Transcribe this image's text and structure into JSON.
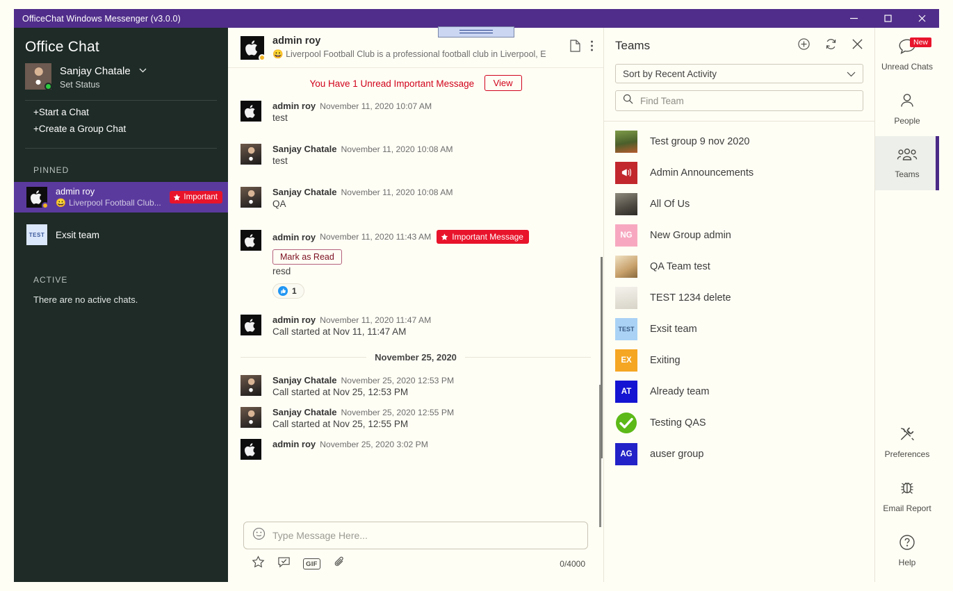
{
  "window": {
    "title": "OfficeChat Windows Messenger (v3.0.0)",
    "minimize": "–",
    "maximize": "□",
    "close": "✕",
    "titlebar_color": "#502D8A"
  },
  "sidebar": {
    "brand": "Office Chat",
    "user": {
      "name": "Sanjay Chatale",
      "status": "Set Status",
      "presence_color": "#2ECC40"
    },
    "actions": [
      {
        "label": "+Start a Chat"
      },
      {
        "label": "+Create a Group Chat"
      }
    ],
    "pinned_header": "PINNED",
    "pinned": [
      {
        "name": "admin roy",
        "preview": "Liverpool Football Club...",
        "emoji": "😀",
        "badge": "Important",
        "badge_color": "#E8142B",
        "selected": true,
        "avatar_type": "apple",
        "presence_color": "#F0B323"
      },
      {
        "name": "Exsit team",
        "preview": "",
        "badge": "",
        "selected": false,
        "avatar_type": "test",
        "avatar_text": "TEST"
      }
    ],
    "active_header": "ACTIVE",
    "active_empty": "There are no active chats."
  },
  "chat": {
    "header": {
      "name": "admin roy",
      "emoji": "😀",
      "status_text": "Liverpool Football Club is a professional football club in Liverpool, E",
      "presence_color": "#F0B323"
    },
    "unread_banner": {
      "text": "You Have 1 Unread Important Message",
      "button": "View",
      "color": "#D0021B"
    },
    "messages": [
      {
        "author": "admin roy",
        "time": "November 11, 2020 10:07 AM",
        "text": "test",
        "avatar": "apple"
      },
      {
        "author": "Sanjay Chatale",
        "time": "November 11, 2020 10:08 AM",
        "text": "test",
        "avatar": "face"
      },
      {
        "author": "Sanjay Chatale",
        "time": "November 11, 2020 10:08 AM",
        "text": "QA",
        "avatar": "face"
      },
      {
        "author": "admin roy",
        "time": "November 11, 2020 11:43 AM",
        "text": "resd",
        "avatar": "apple",
        "tag": "Important Message",
        "action": "Mark as Read",
        "reaction": {
          "icon": "thumbs-up",
          "count": "1"
        }
      },
      {
        "author": "admin roy",
        "time": "November 11, 2020 11:47 AM",
        "text": "Call started at Nov 11, 11:47 AM",
        "avatar": "apple"
      }
    ],
    "date_separator": "November 25, 2020",
    "messages_after": [
      {
        "author": "Sanjay Chatale",
        "time": "November 25, 2020 12:53 PM",
        "text": "Call started at Nov 25, 12:53 PM",
        "avatar": "face"
      },
      {
        "author": "Sanjay Chatale",
        "time": "November 25, 2020 12:55 PM",
        "text": "Call started at Nov 25, 12:55 PM",
        "avatar": "face"
      },
      {
        "author": "admin roy",
        "time": "November 25, 2020 3:02 PM",
        "text": "",
        "avatar": "apple"
      }
    ],
    "composer": {
      "placeholder": "Type Message Here...",
      "value": "",
      "counter": "0/4000",
      "tools": [
        "star-icon",
        "sticker-icon",
        "gif-icon",
        "attachment-icon"
      ],
      "gif_label": "GIF"
    }
  },
  "teams": {
    "title": "Teams",
    "actions": [
      "add-team-icon",
      "refresh-icon",
      "close-icon"
    ],
    "sort": {
      "value": "Sort by Recent Activity"
    },
    "search": {
      "placeholder": "Find Team",
      "value": ""
    },
    "items": [
      {
        "name": "Test group 9 nov 2020",
        "avatar_kind": "photo",
        "avatar_color": "#6f8a3d",
        "initials": ""
      },
      {
        "name": "Admin Announcements",
        "avatar_kind": "icon",
        "avatar_color": "#C1272D",
        "initials": ""
      },
      {
        "name": "All Of Us",
        "avatar_kind": "photo",
        "avatar_color": "#7d7a6e",
        "initials": ""
      },
      {
        "name": "New Group admin",
        "avatar_kind": "initials",
        "avatar_color": "#F7A8C0",
        "initials": "NG"
      },
      {
        "name": "QA Team test",
        "avatar_kind": "photo",
        "avatar_color": "#d8c49a",
        "initials": ""
      },
      {
        "name": "TEST 1234 delete",
        "avatar_kind": "photo",
        "avatar_color": "#e9e6dd",
        "initials": ""
      },
      {
        "name": "Exsit team",
        "avatar_kind": "initials",
        "avatar_color": "#A9D2F5",
        "initials": "TEST"
      },
      {
        "name": "Exiting",
        "avatar_kind": "initials",
        "avatar_color": "#F5A623",
        "initials": "EX"
      },
      {
        "name": "Already team",
        "avatar_kind": "initials",
        "avatar_color": "#1414D2",
        "initials": "AT"
      },
      {
        "name": "Testing QAS",
        "avatar_kind": "check",
        "avatar_color": "#5CB917",
        "initials": ""
      },
      {
        "name": "auser group",
        "avatar_kind": "initials",
        "avatar_color": "#2222C8",
        "initials": "AG"
      }
    ]
  },
  "rail": {
    "top": [
      {
        "label": "Unread Chats",
        "icon": "chat-bubble-icon",
        "badge": "New",
        "active": false
      },
      {
        "label": "People",
        "icon": "person-icon",
        "badge": "",
        "active": false
      },
      {
        "label": "Teams",
        "icon": "people-group-icon",
        "badge": "",
        "active": true
      }
    ],
    "bottom": [
      {
        "label": "Preferences",
        "icon": "tools-icon"
      },
      {
        "label": "Email Report",
        "icon": "bug-icon"
      },
      {
        "label": "Help",
        "icon": "question-circle-icon"
      }
    ],
    "accent_color": "#4A2A87"
  }
}
